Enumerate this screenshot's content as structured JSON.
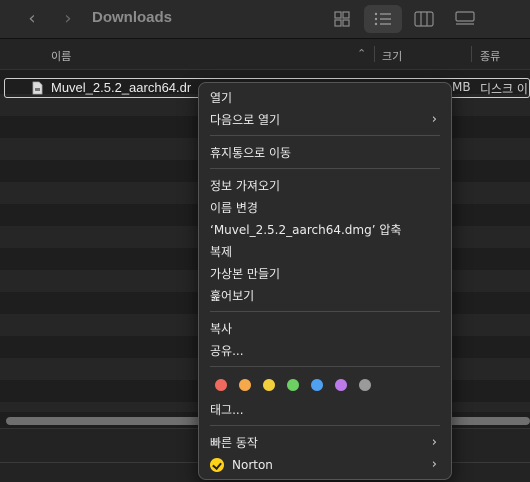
{
  "toolbar": {
    "title": "Downloads",
    "back_icon": "chevron-left",
    "forward_icon": "chevron-right",
    "view_buttons": [
      "grid-view",
      "list-view",
      "column-view",
      "gallery-view"
    ],
    "active_view": "list-view"
  },
  "columns": {
    "name": "이름",
    "size": "크기",
    "kind": "종류"
  },
  "file": {
    "name": "Muvel_2.5.2_aarch64.dr",
    "size": "MB",
    "kind": "디스크 이"
  },
  "context_menu": {
    "open": "열기",
    "open_with": "다음으로 열기",
    "move_to_trash": "휴지통으로 이동",
    "get_info": "정보 가져오기",
    "rename": "이름 변경",
    "compress": "‘Muvel_2.5.2_aarch64.dmg’ 압축",
    "duplicate": "복제",
    "make_alias": "가상본 만들기",
    "quick_look": "훑어보기",
    "copy": "복사",
    "share": "공유...",
    "tag_colors": [
      "#ee6a5f",
      "#f5a94a",
      "#f4cf3d",
      "#6dcf63",
      "#4fa0f0",
      "#bc7ae8",
      "#9a9a9a"
    ],
    "tags": "태그...",
    "quick_actions": "빠른 동작",
    "norton": "Norton"
  }
}
